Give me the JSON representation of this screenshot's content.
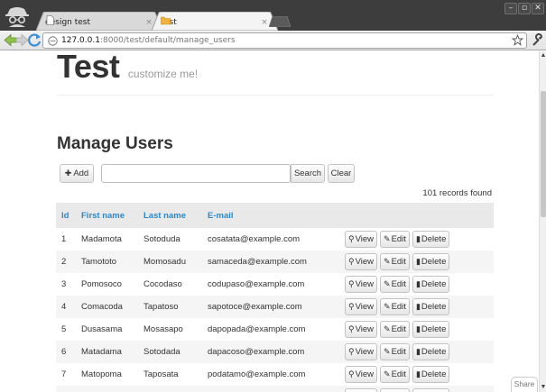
{
  "browser": {
    "tabs": [
      {
        "title": "design test",
        "close": "×",
        "active": false
      },
      {
        "title": "Test",
        "close": "×",
        "active": true
      }
    ],
    "window_buttons": {
      "minimize": "–",
      "maximize": "▫",
      "close": "✕"
    },
    "url_host": "127.0.0.1",
    "url_rest": ":8000/test/default/manage_users"
  },
  "brand": {
    "title": "Test",
    "tagline": "customize me!"
  },
  "page": {
    "heading": "Manage Users",
    "add_label": "Add",
    "search_value": "",
    "search_label": "Search",
    "clear_label": "Clear",
    "records_found": "101 records found"
  },
  "table": {
    "columns": [
      "Id",
      "First name",
      "Last name",
      "E-mail"
    ],
    "actions": {
      "view": "View",
      "edit": "Edit",
      "delete": "Delete"
    },
    "rows": [
      {
        "id": "1",
        "first": "Madamota",
        "last": "Sotoduda",
        "email": "cosatata@example.com"
      },
      {
        "id": "2",
        "first": "Tamototo",
        "last": "Momosadu",
        "email": "samaceda@example.com"
      },
      {
        "id": "3",
        "first": "Pomosoco",
        "last": "Cocodaso",
        "email": "codupaso@example.com"
      },
      {
        "id": "4",
        "first": "Comacoda",
        "last": "Tapatoso",
        "email": "sapotoce@example.com"
      },
      {
        "id": "5",
        "first": "Dusasama",
        "last": "Mosasapo",
        "email": "dapopada@example.com"
      },
      {
        "id": "6",
        "first": "Matadama",
        "last": "Sotodada",
        "email": "dapacoso@example.com"
      },
      {
        "id": "7",
        "first": "Matopoma",
        "last": "Taposata",
        "email": "podatamo@example.com"
      },
      {
        "id": "",
        "first": "",
        "last": "",
        "email": ""
      }
    ]
  },
  "share_label": "Share",
  "colors": {
    "header_link": "#2b8ac9",
    "row_stripe": "#f5f5f5",
    "header_bg": "#e9e9e9"
  }
}
